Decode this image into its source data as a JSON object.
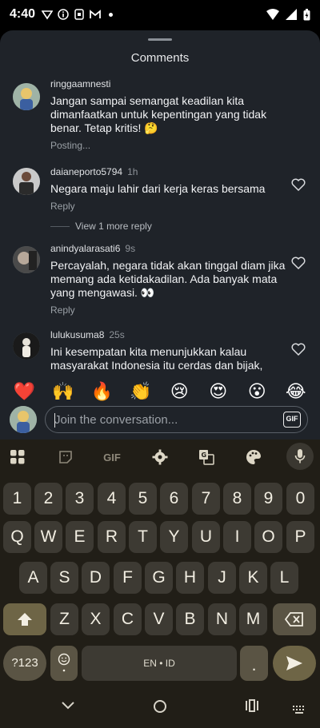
{
  "status_bar": {
    "time": "4:40"
  },
  "sheet": {
    "title": "Comments"
  },
  "comments": [
    {
      "user": "ringgaamnesti",
      "ago": "",
      "text": "Jangan sampai semangat keadilan kita dimanfaatkan untuk kepentingan yang tidak benar. Tetap kritis! 🤔",
      "meta": "Posting..."
    },
    {
      "user": "daianeporto5794",
      "ago": "1h",
      "text": "Negara maju lahir dari kerja keras bersama",
      "meta": "Reply"
    },
    {
      "user": "anindyalarasati6",
      "ago": "9s",
      "text": "Percayalah, negara tidak akan tinggal diam jika memang ada ketidakadilan. Ada banyak mata yang mengawasi. 👀",
      "meta": "Reply"
    },
    {
      "user": "lulukusuma8",
      "ago": "25s",
      "text": "Ini kesempatan kita menunjukkan kalau masyarakat Indonesia itu cerdas dan bijak,",
      "meta": ""
    }
  ],
  "view_more": "View 1 more reply",
  "emoji_bar": [
    "❤️",
    "🙌",
    "🔥",
    "👏",
    "😢",
    "😍",
    "😮",
    "😂"
  ],
  "composer": {
    "placeholder": "Join the conversation...",
    "gif_label": "GIF"
  },
  "keyboard": {
    "toolbar": {
      "gif_label": "GIF"
    },
    "row1": [
      "1",
      "2",
      "3",
      "4",
      "5",
      "6",
      "7",
      "8",
      "9",
      "0"
    ],
    "row2": [
      "Q",
      "W",
      "E",
      "R",
      "T",
      "Y",
      "U",
      "I",
      "O",
      "P"
    ],
    "row3": [
      "A",
      "S",
      "D",
      "F",
      "G",
      "H",
      "J",
      "K",
      "L"
    ],
    "row4": [
      "Z",
      "X",
      "C",
      "V",
      "B",
      "N",
      "M"
    ],
    "symbols_label": "?123",
    "space_label": "EN • ID",
    "period_label": "."
  }
}
